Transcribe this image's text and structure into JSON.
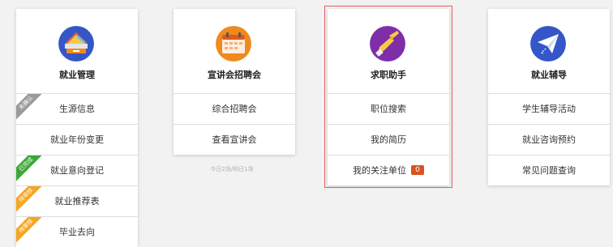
{
  "cards": [
    {
      "title": "就业管理",
      "icon": "laptop-books-icon",
      "items": [
        {
          "label": "生源信息",
          "ribbon": "未确认",
          "ribbon_color": "#9a9a9a"
        },
        {
          "label": "就业年份变更"
        },
        {
          "label": "就业意向登记",
          "ribbon": "已完成",
          "ribbon_color": "#3aa835"
        },
        {
          "label": "就业推荐表",
          "ribbon": "待审核",
          "ribbon_color": "#f5a623"
        },
        {
          "label": "毕业去向",
          "ribbon": "待审核",
          "ribbon_color": "#f5a623"
        }
      ]
    },
    {
      "title": "宣讲会招聘会",
      "icon": "calendar-icon",
      "items": [
        {
          "label": "综合招聘会"
        },
        {
          "label": "查看宣讲会"
        }
      ],
      "footnote": "今日2场/明日1场"
    },
    {
      "title": "求职助手",
      "icon": "pointing-hand-icon",
      "items": [
        {
          "label": "职位搜索"
        },
        {
          "label": "我的简历"
        },
        {
          "label": "我的关注单位",
          "badge": "0"
        }
      ]
    },
    {
      "title": "就业辅导",
      "icon": "paper-plane-icon",
      "items": [
        {
          "label": "学生辅导活动"
        },
        {
          "label": "就业咨询预约"
        },
        {
          "label": "常见问题查询"
        }
      ]
    }
  ],
  "colors": {
    "accent_red": "#e35d5d",
    "badge_orange": "#d9531e",
    "icon_blue": "#3456c8",
    "icon_orange": "#f08a1c",
    "icon_purple": "#7e2fa8"
  }
}
